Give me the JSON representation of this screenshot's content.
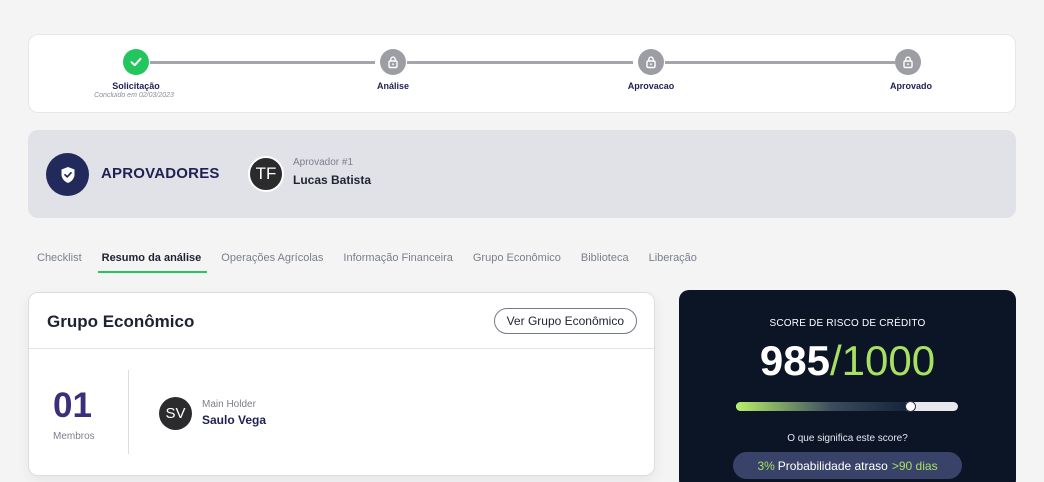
{
  "stepper": {
    "steps": [
      {
        "label": "Solicitação",
        "sublabel": "Concluido em 02/03/2023",
        "status": "done"
      },
      {
        "label": "Análise",
        "sublabel": "",
        "status": "locked"
      },
      {
        "label": "Aprovacao",
        "sublabel": "",
        "status": "locked"
      },
      {
        "label": "Aprovado",
        "sublabel": "",
        "status": "locked"
      }
    ]
  },
  "approvers": {
    "title": "APROVADORES",
    "approver": {
      "initials": "TF",
      "role": "Aprovador #1",
      "name": "Lucas Batista"
    }
  },
  "tabs": [
    {
      "label": "Checklist",
      "active": false
    },
    {
      "label": "Resumo da análise",
      "active": true
    },
    {
      "label": "Operações Agrícolas",
      "active": false
    },
    {
      "label": "Informação Financeira",
      "active": false
    },
    {
      "label": "Grupo Econômico",
      "active": false
    },
    {
      "label": "Biblioteca",
      "active": false
    },
    {
      "label": "Liberação",
      "active": false
    }
  ],
  "economic_group": {
    "title": "Grupo Econômico",
    "button_label": "Ver Grupo Econômico",
    "members_count": "01",
    "members_label": "Membros",
    "holder": {
      "initials": "SV",
      "role": "Main Holder",
      "name": "Saulo Vega"
    }
  },
  "score": {
    "title": "SCORE DE RISCO DE CRÉDITO",
    "value": "985",
    "max": "/1000",
    "fraction": 0.785,
    "question": "O que significa este score?",
    "pill_percent": "3%",
    "pill_text": "Probabilidade atraso",
    "pill_days": ">90 dias"
  },
  "colors": {
    "success": "#22c55e",
    "navy": "#1e2152",
    "score_accent": "#a8e063",
    "score_bg": "#0c1526"
  }
}
